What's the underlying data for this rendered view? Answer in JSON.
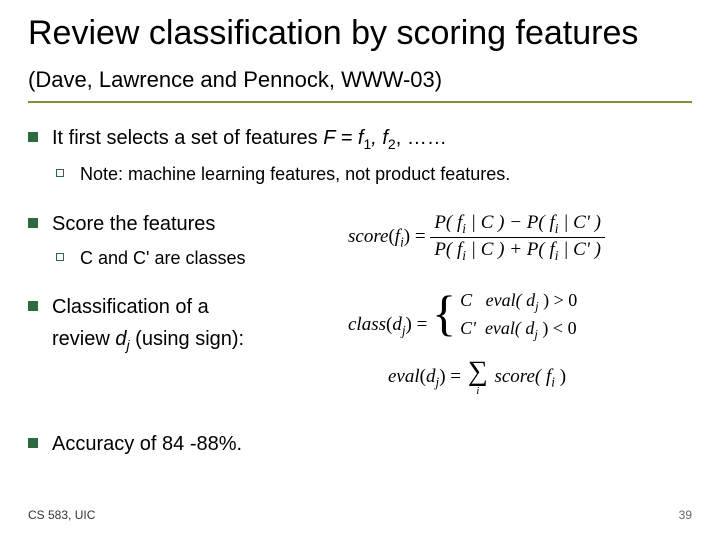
{
  "title_main": "Review classification by scoring features",
  "title_sub": "(Dave, Lawrence and Pennock, WWW-03)",
  "bullets": {
    "b1": "It first selects a set of features ",
    "b1_formula": "F = f",
    "b1_sub1": "1",
    "b1_mid": ", f",
    "b1_sub2": "2",
    "b1_tail": ", ……",
    "b1_note": "Note: machine learning features, not product features.",
    "b2": "Score the features",
    "b2_note": "C and C' are classes",
    "b3a": "Classification of a",
    "b3b": "review ",
    "b3b_var": "d",
    "b3b_sub": "j",
    "b3b_tail": " (using sign):",
    "b4": "Accuracy of 84 -88%."
  },
  "formulas": {
    "score_lhs": "score",
    "score_arg_open": "(",
    "score_arg_var": "f",
    "score_arg_sub": "i",
    "score_arg_close": ")",
    "eq": " = ",
    "num_l": "P( f",
    "num_l_sub": "i",
    "num_mid": " | C ) − P( f",
    "num_r_sub": "i",
    "num_r": " | C' )",
    "den_l": "P( f",
    "den_l_sub": "i",
    "den_mid": " | C ) + P( f",
    "den_r_sub": "i",
    "den_r": " | C' )",
    "class_lhs": "class",
    "d_var": "d",
    "d_sub": "j",
    "case1_lhs": "C",
    "case1_rhs": "eval( d",
    "case1_sub": "j",
    "case1_tail": " ) > 0",
    "case2_lhs": "C'",
    "case2_rhs": "eval( d",
    "case2_sub": "j",
    "case2_tail": " ) < 0",
    "eval_lhs": "eval",
    "sum_sub": "i",
    "sum_term": "score( f",
    "sum_term_sub": "i",
    "sum_term_tail": " )"
  },
  "footer": {
    "left": "CS 583, UIC",
    "right": "39"
  }
}
